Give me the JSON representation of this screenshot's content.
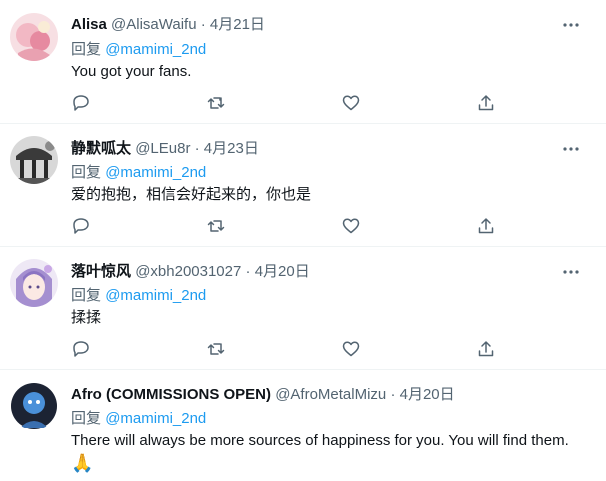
{
  "colors": {
    "name": "#0f1419",
    "muted": "#536471",
    "mention": "#1d9bf0",
    "divider": "#eff3f4"
  },
  "tweets": [
    {
      "name": "Alisa",
      "handle": "@AlisaWaifu",
      "dot": "·",
      "date": "4月21日",
      "reply_prefix": "回复",
      "reply_to": "@mamimi_2nd",
      "text": "You got your fans."
    },
    {
      "name": "静默呱太",
      "handle": "@LEu8r",
      "dot": "·",
      "date": "4月23日",
      "reply_prefix": "回复",
      "reply_to": "@mamimi_2nd",
      "text": "爱的抱抱，相信会好起来的，你也是"
    },
    {
      "name": "落叶惊风",
      "handle": "@xbh20031027",
      "dot": "·",
      "date": "4月20日",
      "reply_prefix": "回复",
      "reply_to": "@mamimi_2nd",
      "text": "揉揉"
    },
    {
      "name": "Afro (COMMISSIONS OPEN)",
      "handle": "@AfroMetalMizu",
      "dot": "·",
      "date": "4月20日",
      "reply_prefix": "回复",
      "reply_to": "@mamimi_2nd",
      "text": "There will always be more sources of happiness for you. You will find them.",
      "emoji": "🙏"
    }
  ],
  "icons": [
    "reply-icon",
    "retweet-icon",
    "like-icon",
    "share-icon",
    "more-icon"
  ]
}
